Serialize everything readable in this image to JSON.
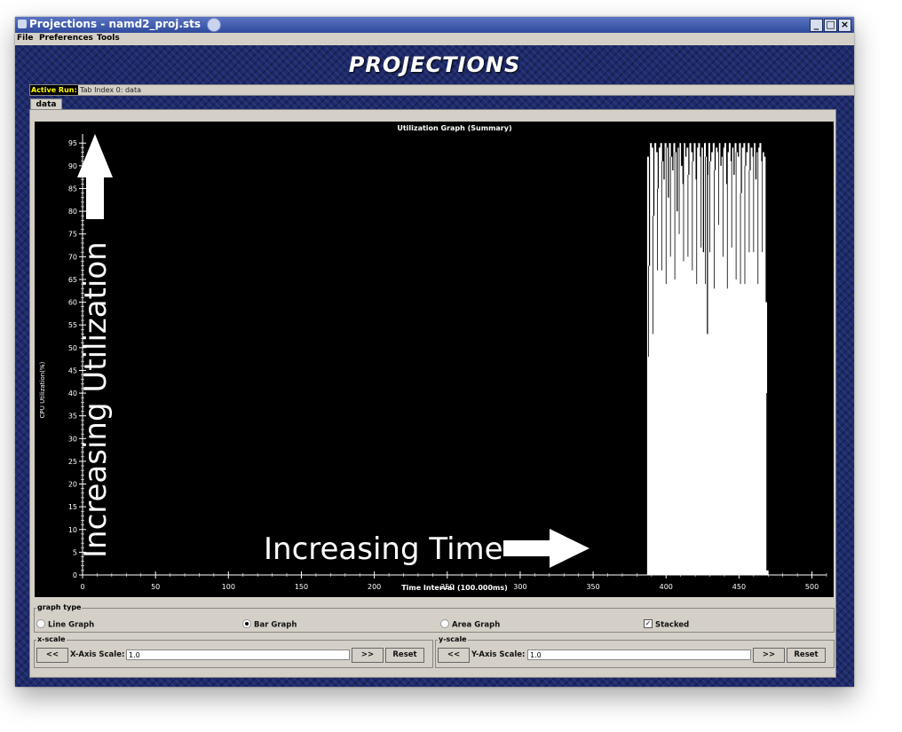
{
  "window": {
    "title": "Projections - namd2_proj.sts",
    "controls": [
      "minimize-icon",
      "maximize-icon",
      "close-icon"
    ]
  },
  "menu": {
    "items": [
      "File",
      "Preferences",
      "Tools"
    ]
  },
  "app": {
    "logo": "PROJECTIONS"
  },
  "active_run": {
    "label": "Active Run:",
    "value": "Tab Index 0: data"
  },
  "tabs": [
    {
      "label": "data"
    }
  ],
  "chart_data": {
    "type": "bar",
    "title": "Utilization Graph (Summary)",
    "xlabel": "Time Interval (100.000ms)",
    "ylabel": "CPU Utilization(%)",
    "xlim": [
      0,
      510
    ],
    "ylim": [
      0,
      97
    ],
    "xticks": [
      0,
      50,
      100,
      150,
      200,
      250,
      300,
      350,
      400,
      450,
      500
    ],
    "yticks": [
      0,
      5,
      10,
      15,
      20,
      25,
      30,
      35,
      40,
      45,
      50,
      55,
      60,
      65,
      70,
      75,
      80,
      85,
      90,
      95
    ],
    "x": [
      387,
      388,
      389,
      390,
      391,
      392,
      393,
      394,
      395,
      396,
      397,
      398,
      399,
      400,
      401,
      402,
      403,
      404,
      405,
      406,
      407,
      408,
      409,
      410,
      411,
      412,
      413,
      414,
      415,
      416,
      417,
      418,
      419,
      420,
      421,
      422,
      423,
      424,
      425,
      426,
      427,
      428,
      429,
      430,
      431,
      432,
      433,
      434,
      435,
      436,
      437,
      438,
      439,
      440,
      441,
      442,
      443,
      444,
      445,
      446,
      447,
      448,
      449,
      450,
      451,
      452,
      453,
      454,
      455,
      456,
      457,
      458,
      459,
      460,
      461,
      462,
      463,
      464,
      465,
      466,
      467,
      468,
      469
    ],
    "values": [
      92,
      68,
      95,
      94,
      79,
      95,
      93,
      85,
      94,
      95,
      91,
      87,
      95,
      94,
      83,
      95,
      92,
      89,
      95,
      93,
      80,
      94,
      95,
      90,
      86,
      95,
      92,
      94,
      88,
      95,
      93,
      91,
      95,
      87,
      94,
      95,
      92,
      94,
      71,
      95,
      92,
      88,
      95,
      91,
      93,
      95,
      89,
      94,
      93,
      95,
      90,
      92,
      94,
      95,
      86,
      93,
      95,
      91,
      94,
      88,
      95,
      93,
      92,
      95,
      84,
      94,
      95,
      90,
      93,
      95,
      89,
      94,
      92,
      95,
      87,
      93,
      94,
      95,
      91,
      93,
      92,
      60,
      1
    ],
    "dips": [
      {
        "x": 428,
        "value": 53
      }
    ],
    "grid": false,
    "annotations": [
      "Increasing Utilization",
      "Increasing Time"
    ]
  },
  "graph_type": {
    "legend": "graph type",
    "options": [
      {
        "label": "Line Graph",
        "selected": false
      },
      {
        "label": "Bar Graph",
        "selected": true
      },
      {
        "label": "Area Graph",
        "selected": false
      }
    ],
    "stacked": {
      "label": "Stacked",
      "checked": true
    }
  },
  "x_scale": {
    "legend": "x-scale",
    "dec": "<<",
    "label": "X-Axis Scale:",
    "value": "1.0",
    "inc": ">>",
    "reset": "Reset"
  },
  "y_scale": {
    "legend": "y-scale",
    "dec": "<<",
    "label": "Y-Axis Scale:",
    "value": "1.0",
    "inc": ">>",
    "reset": "Reset"
  }
}
